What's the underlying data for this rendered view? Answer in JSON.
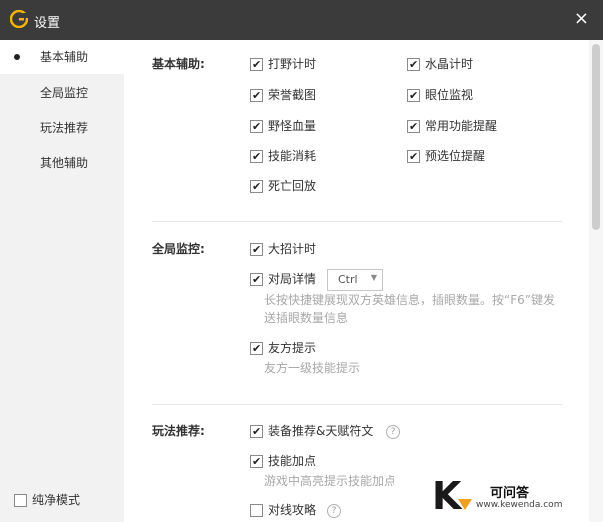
{
  "window": {
    "title": "设置",
    "close_label": "×"
  },
  "sidebar": {
    "items": [
      {
        "label": "基本辅助",
        "active": true
      },
      {
        "label": "全局监控",
        "active": false
      },
      {
        "label": "玩法推荐",
        "active": false
      },
      {
        "label": "其他辅助",
        "active": false
      }
    ],
    "pure_mode": {
      "label": "纯净模式",
      "checked": false
    }
  },
  "sections": {
    "basic": {
      "label": "基本辅助:",
      "options": [
        {
          "label": "打野计时",
          "checked": true
        },
        {
          "label": "水晶计时",
          "checked": true
        },
        {
          "label": "荣誉截图",
          "checked": true
        },
        {
          "label": "眼位监视",
          "checked": true
        },
        {
          "label": "野怪血量",
          "checked": true
        },
        {
          "label": "常用功能提醒",
          "checked": true
        },
        {
          "label": "技能消耗",
          "checked": true
        },
        {
          "label": "预选位提醒",
          "checked": true
        },
        {
          "label": "死亡回放",
          "checked": true
        }
      ]
    },
    "monitor": {
      "label": "全局监控:",
      "ult_timer": {
        "label": "大招计时",
        "checked": true
      },
      "match_detail": {
        "label": "对局详情",
        "checked": true,
        "hotkey": "Ctrl",
        "hint": "长按快捷键展现双方英雄信息，插眼数量。按“F6”键发送插眼数量信息"
      },
      "ally_tips": {
        "label": "友方提示",
        "checked": true,
        "hint": "友方一级技能提示"
      }
    },
    "recommend": {
      "label": "玩法推荐:",
      "equip": {
        "label": "装备推荐&天赋符文",
        "checked": true
      },
      "skill": {
        "label": "技能加点",
        "checked": true,
        "hint": "游戏中高亮提示技能加点"
      },
      "lane": {
        "label": "对线攻略",
        "checked": false
      }
    }
  },
  "help_icon_text": "?",
  "check_glyph": "✔",
  "watermark": {
    "letter": "K",
    "name": "可问答",
    "url": "www.kewenda.com"
  }
}
